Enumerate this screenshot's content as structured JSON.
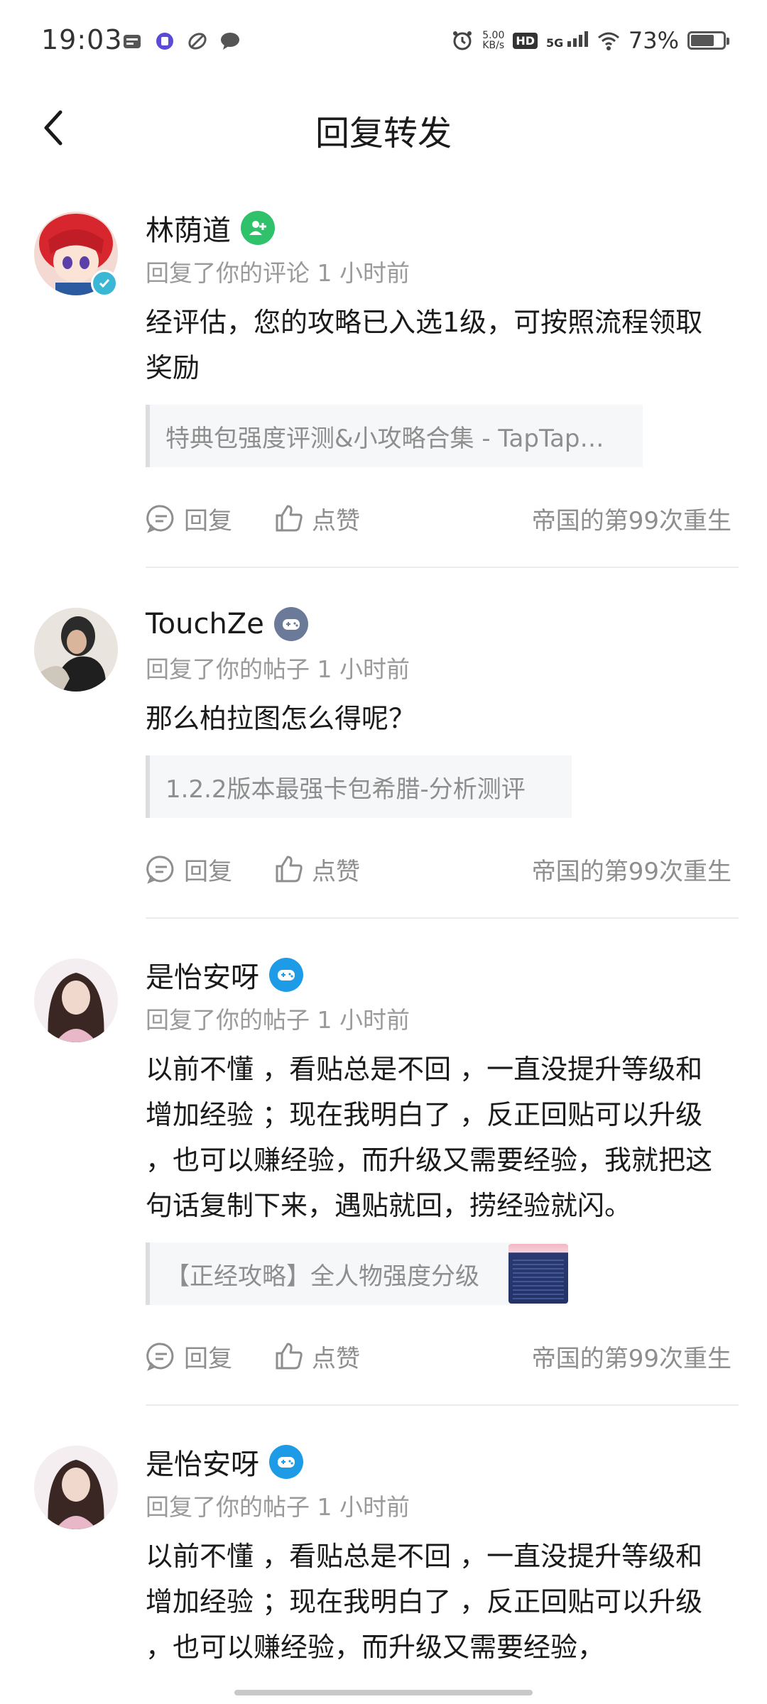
{
  "status_bar": {
    "time": "19:03",
    "net_speed_value": "5.00",
    "net_speed_unit": "KB/s",
    "hd": "HD",
    "network": "5G",
    "battery_percent": "73%",
    "battery_level": 0.73
  },
  "header": {
    "title": "回复转发"
  },
  "items": [
    {
      "name": "林荫道",
      "meta": "回复了你的评论 1 小时前",
      "content": "经评估，您的攻略已入选1级，可按照流程领取奖励",
      "quote": "特典包强度评测&小攻略合集 - TapTap…",
      "reply_label": "回复",
      "like_label": "点赞",
      "game": "帝国的第99次重生"
    },
    {
      "name": "TouchZe",
      "meta": "回复了你的帖子 1 小时前",
      "content": "那么柏拉图怎么得呢？",
      "quote": "1.2.2版本最强卡包希腊-分析测评",
      "reply_label": "回复",
      "like_label": "点赞",
      "game": "帝国的第99次重生"
    },
    {
      "name": "是怡安呀",
      "meta": "回复了你的帖子 1 小时前",
      "content": "以前不懂 ，看贴总是不回 ，一直没提升等级和增加经验 ；现在我明白了 ，反正回贴可以升级 ，也可以赚经验，而升级又需要经验，我就把这句话复制下来，遇贴就回，捞经验就闪。",
      "quote": "【正经攻略】全人物强度分级",
      "reply_label": "回复",
      "like_label": "点赞",
      "game": "帝国的第99次重生"
    },
    {
      "name": "是怡安呀",
      "meta": "回复了你的帖子 1 小时前",
      "content": "以前不懂 ，看贴总是不回 ，一直没提升等级和增加经验 ；现在我明白了 ，反正回贴可以升级 ，也可以赚经验，而升级又需要经验，"
    }
  ],
  "colors": {
    "badge_green": "#2fc26b",
    "badge_slate": "#6b7a99",
    "badge_blue": "#1e9be6",
    "verified_teal": "#3bb7d6"
  }
}
